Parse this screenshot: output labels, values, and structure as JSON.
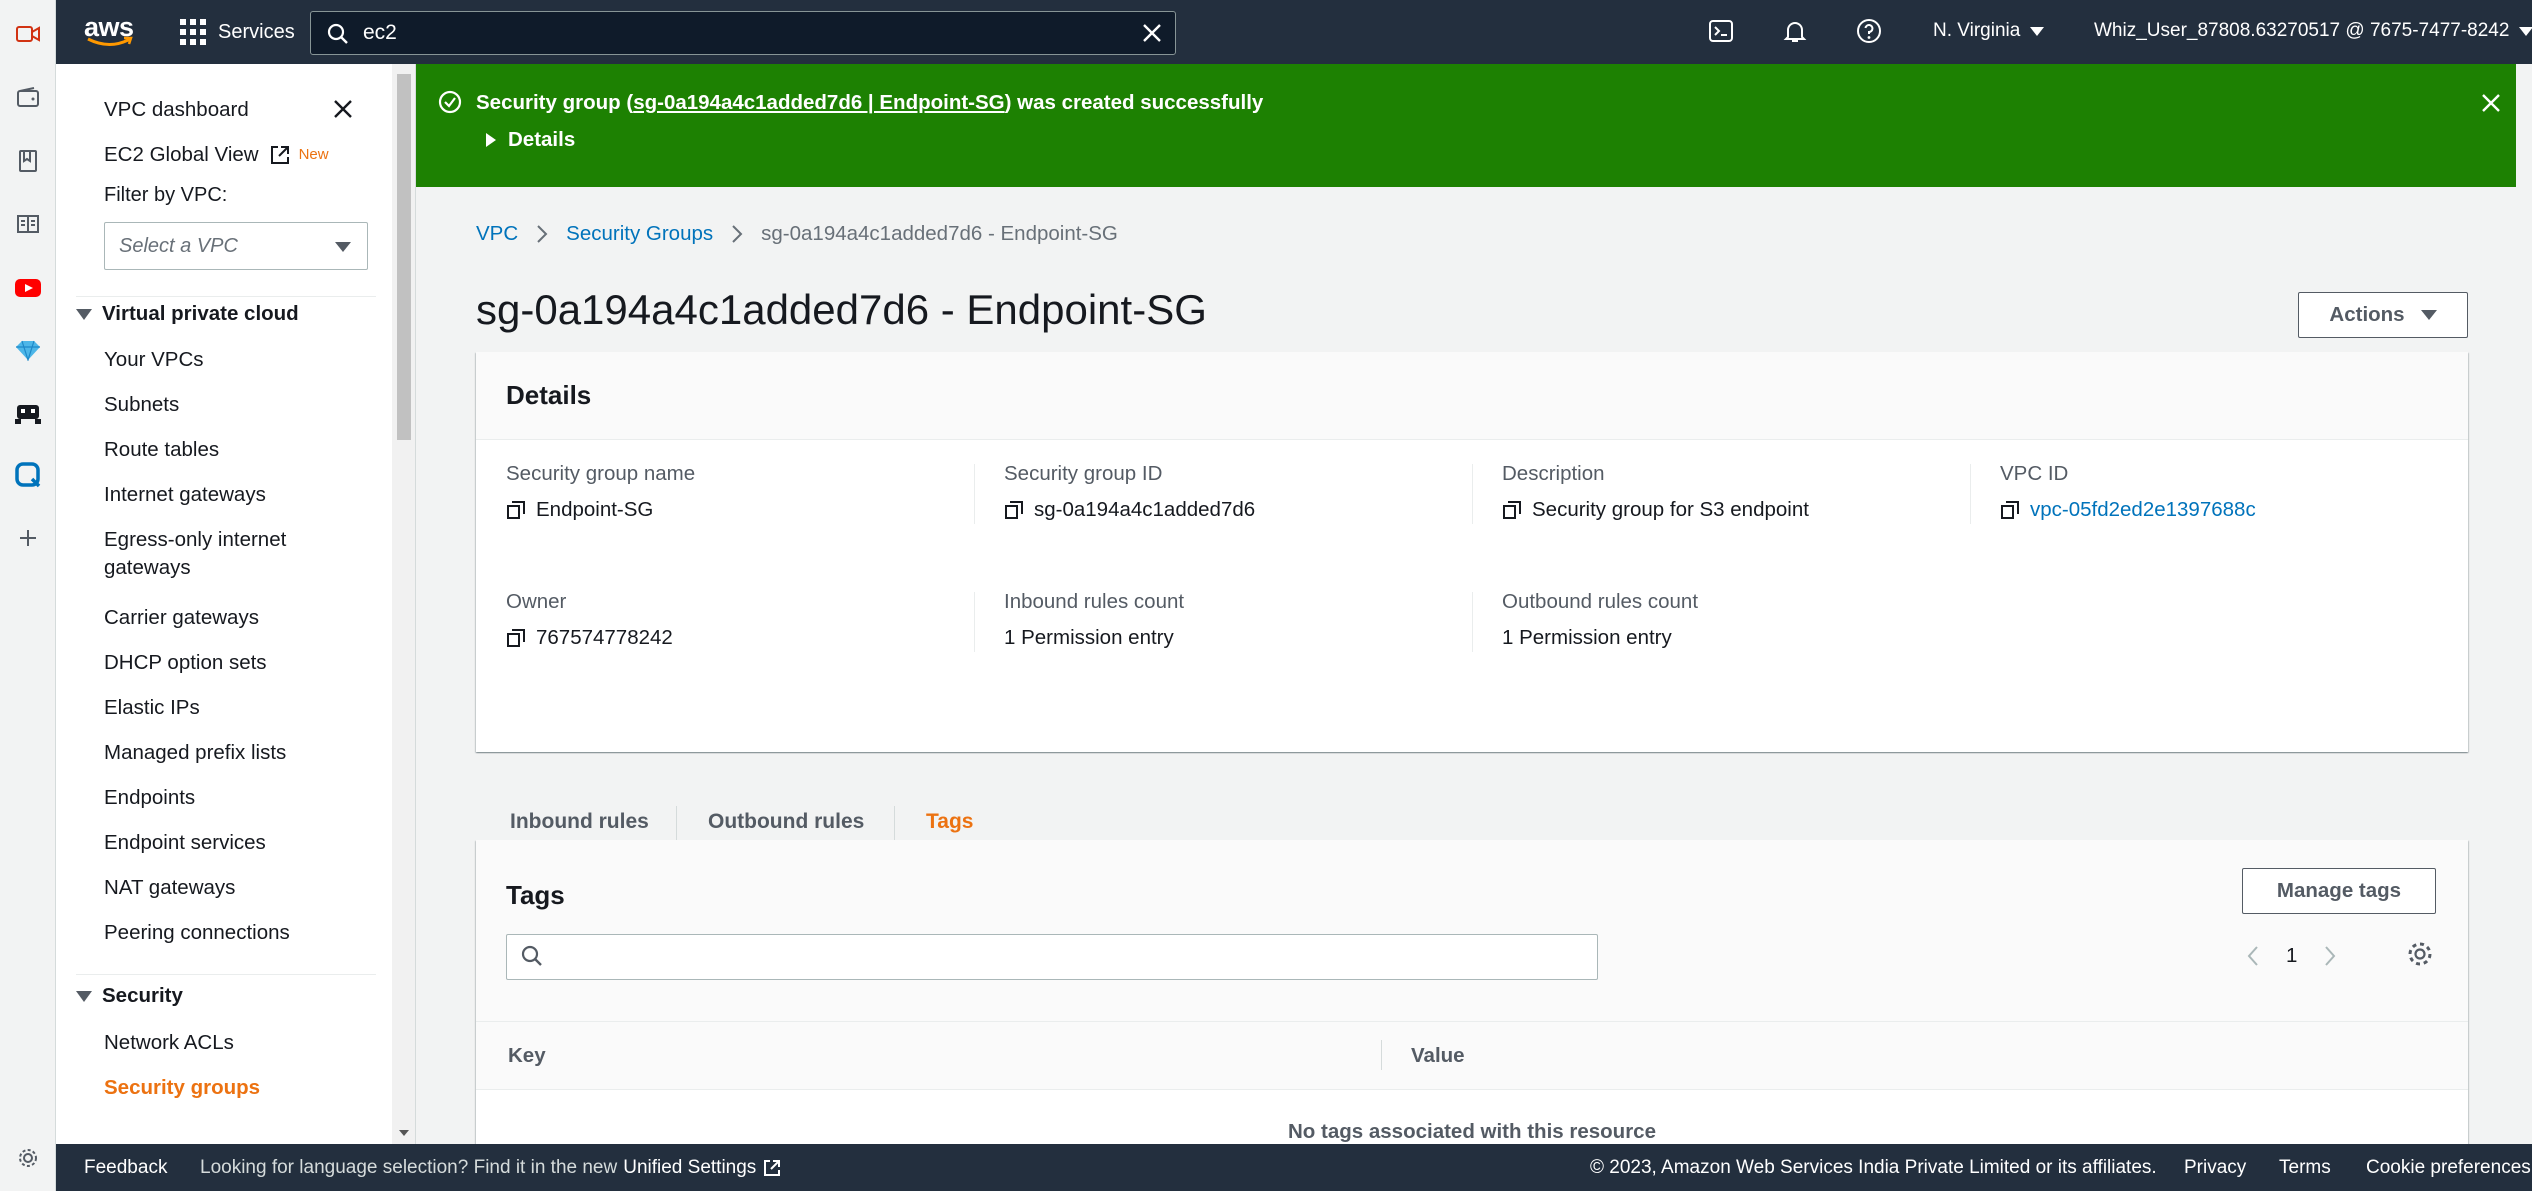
{
  "topnav": {
    "logo_text": "aws",
    "services_label": "Services",
    "search_value": "ec2",
    "region": "N. Virginia",
    "account": "Whiz_User_87808.63270517 @ 7675-7477-8242"
  },
  "sidebar": {
    "dashboard": "VPC dashboard",
    "global_view": "EC2 Global View",
    "global_view_badge": "New",
    "filter_label": "Filter by VPC:",
    "vpc_select_placeholder": "Select a VPC",
    "section_vpc": "Virtual private cloud",
    "vpc_items": [
      "Your VPCs",
      "Subnets",
      "Route tables",
      "Internet gateways",
      "Egress-only internet gateways",
      "Carrier gateways",
      "DHCP option sets",
      "Elastic IPs",
      "Managed prefix lists",
      "Endpoints",
      "Endpoint services",
      "NAT gateways",
      "Peering connections"
    ],
    "section_security": "Security",
    "security_items": [
      "Network ACLs",
      "Security groups"
    ]
  },
  "flash": {
    "prefix": "Security group (",
    "link": "sg-0a194a4c1added7d6 | Endpoint-SG",
    "suffix": ") was created successfully",
    "details": "Details"
  },
  "breadcrumb": {
    "root": "VPC",
    "parent": "Security Groups",
    "current": "sg-0a194a4c1added7d6 - Endpoint-SG"
  },
  "page": {
    "title": "sg-0a194a4c1added7d6 - Endpoint-SG",
    "actions": "Actions"
  },
  "details": {
    "heading": "Details",
    "sg_name_label": "Security group name",
    "sg_name": "Endpoint-SG",
    "sg_id_label": "Security group ID",
    "sg_id": "sg-0a194a4c1added7d6",
    "description_label": "Description",
    "description": "Security group for S3 endpoint",
    "vpc_id_label": "VPC ID",
    "vpc_id": "vpc-05fd2ed2e1397688c",
    "owner_label": "Owner",
    "owner": "767574778242",
    "inbound_label": "Inbound rules count",
    "inbound": "1 Permission entry",
    "outbound_label": "Outbound rules count",
    "outbound": "1 Permission entry"
  },
  "tabs": [
    "Inbound rules",
    "Outbound rules",
    "Tags"
  ],
  "tags": {
    "heading": "Tags",
    "manage_button": "Manage tags",
    "search_placeholder": "",
    "page": "1",
    "col_key": "Key",
    "col_value": "Value",
    "empty": "No tags associated with this resource"
  },
  "footer": {
    "feedback": "Feedback",
    "lang_text": "Looking for language selection? Find it in the new",
    "lang_link": "Unified Settings",
    "copyright": "© 2023, Amazon Web Services India Private Limited or its affiliates.",
    "privacy": "Privacy",
    "terms": "Terms",
    "cookies": "Cookie preferences"
  },
  "colors": {
    "nav_bg": "#232f3e",
    "success_green": "#1d8102",
    "accent_orange": "#ec7211",
    "link_blue": "#0073bb"
  }
}
